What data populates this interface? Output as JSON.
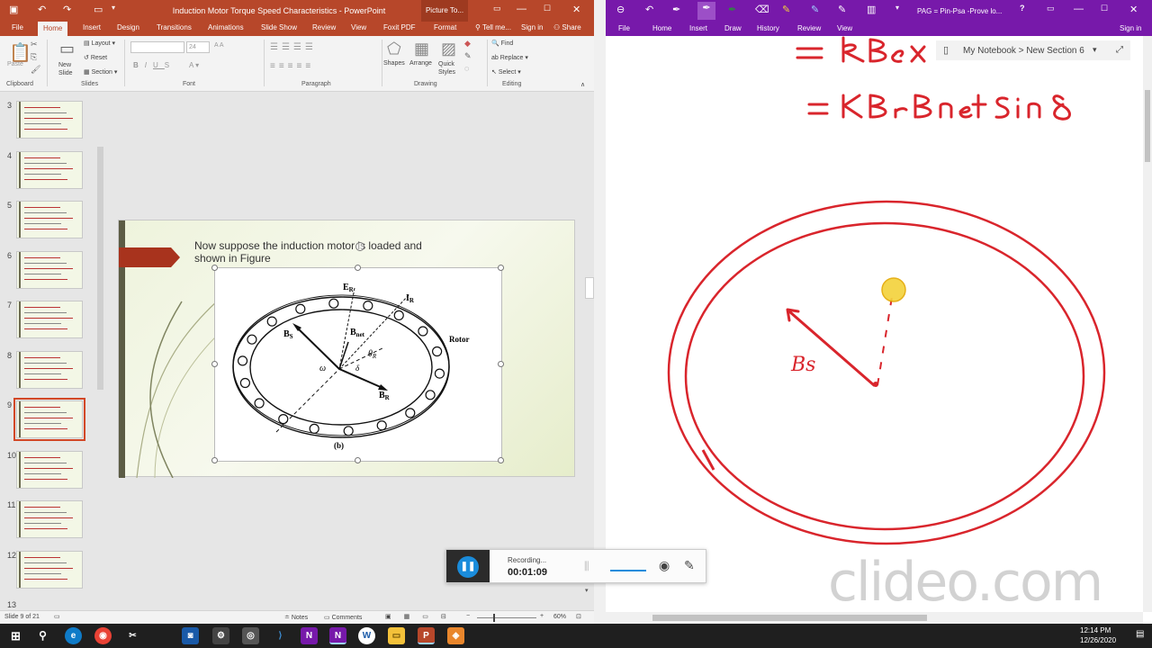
{
  "ppt": {
    "title": "Induction Motor Torque Speed Characteristics - PowerPoint",
    "context_tab": "Picture To...",
    "tell_me": "Tell me...",
    "sign_in": "Sign in",
    "share": "Share",
    "tabs": [
      "File",
      "Home",
      "Insert",
      "Design",
      "Transitions",
      "Animations",
      "Slide Show",
      "Review",
      "View",
      "Foxit PDF",
      "Format"
    ],
    "ribbon": {
      "paste": "Paste",
      "new_slide": "New Slide",
      "layout": "Layout",
      "reset": "Reset",
      "section": "Section",
      "font_size": "24",
      "shapes": "Shapes",
      "arrange": "Arrange",
      "quick_styles": "Quick Styles",
      "find": "Find",
      "replace": "Replace",
      "select": "Select",
      "groups": {
        "clipboard": "Clipboard",
        "slides": "Slides",
        "font": "Font",
        "paragraph": "Paragraph",
        "drawing": "Drawing",
        "editing": "Editing"
      }
    },
    "thumbnail_numbers": [
      "3",
      "4",
      "5",
      "6",
      "7",
      "8",
      "9",
      "10",
      "11",
      "12",
      "13"
    ],
    "selected_slide": "9",
    "slide": {
      "text_line1": "Now suppose the induction motor is loaded and",
      "text_line2": "shown in Figure",
      "figure": {
        "er": "E",
        "er_sub": "R",
        "ir": "I",
        "ir_sub": "R",
        "bnet": "B",
        "bnet_sub": "net",
        "bs": "B",
        "bs_sub": "S",
        "theta": "θ",
        "theta_sub": "R",
        "omega": "ω",
        "delta": "δ",
        "br": "B",
        "br_sub": "R",
        "rotor": "Rotor",
        "caption": "(b)"
      }
    },
    "status": {
      "slide_info": "Slide 9 of 21",
      "notes": "Notes",
      "comments": "Comments",
      "zoom": "60%"
    }
  },
  "onenote": {
    "title": "PAG = Pin-Psa -Prove lo...",
    "question": "?",
    "sign_in": "Sign in",
    "tabs": [
      "File",
      "Home",
      "Insert",
      "Draw",
      "History",
      "Review",
      "View"
    ],
    "notebook": "My Notebook > New Section 6",
    "ink_label": "Bs"
  },
  "recorder": {
    "status": "Recording...",
    "time": "00:01:09"
  },
  "watermark": "clideo.com",
  "clock": {
    "time": "12:14 PM",
    "date": "12/26/2020"
  },
  "colors": {
    "ppt_accent": "#b7472a",
    "onenote_accent": "#7719aa",
    "ink_red": "#d9252c",
    "highlighter": "#f3d23a"
  }
}
